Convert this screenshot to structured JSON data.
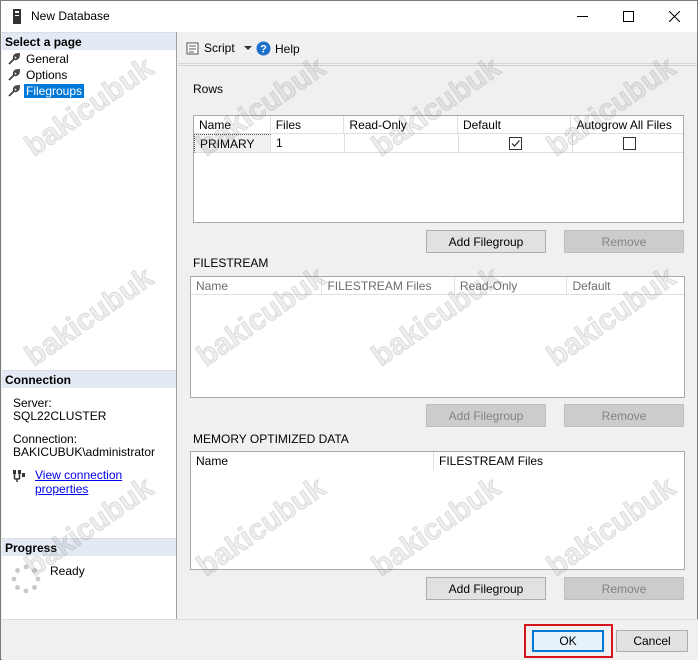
{
  "window": {
    "title": "New Database"
  },
  "left_panel": {
    "select_page_header": "Select a page",
    "pages": [
      {
        "label": "General"
      },
      {
        "label": "Options"
      },
      {
        "label": "Filegroups",
        "selected": true
      }
    ],
    "connection_header": "Connection",
    "server_label": "Server:",
    "server_value": "SQL22CLUSTER",
    "connection_label": "Connection:",
    "connection_value": "BAKICUBUK\\administrator",
    "view_connection_link": "View connection properties",
    "progress_header": "Progress",
    "progress_status": "Ready"
  },
  "toolbar": {
    "script_label": "Script",
    "help_label": "Help"
  },
  "rows_section": {
    "label": "Rows",
    "columns": [
      "Name",
      "Files",
      "Read-Only",
      "Default",
      "Autogrow All Files"
    ],
    "rows": [
      {
        "name": "PRIMARY",
        "files": "1",
        "read_only": "",
        "default_checked": true,
        "autogrow_checked": false
      }
    ],
    "add_button": "Add Filegroup",
    "remove_button": "Remove"
  },
  "filestream_section": {
    "label": "FILESTREAM",
    "columns": [
      "Name",
      "FILESTREAM Files",
      "Read-Only",
      "Default"
    ],
    "add_button": "Add Filegroup",
    "remove_button": "Remove"
  },
  "memory_section": {
    "label": "MEMORY OPTIMIZED DATA",
    "columns": [
      "Name",
      "FILESTREAM Files"
    ],
    "add_button": "Add Filegroup",
    "remove_button": "Remove"
  },
  "footer": {
    "ok_button": "OK",
    "cancel_button": "Cancel"
  },
  "watermark_text": "bakicubuk",
  "colors": {
    "selection": "#0078d7",
    "link": "#0000ee",
    "highlight_box": "#d4141c",
    "section_header_bg": "#e3eaf3"
  }
}
